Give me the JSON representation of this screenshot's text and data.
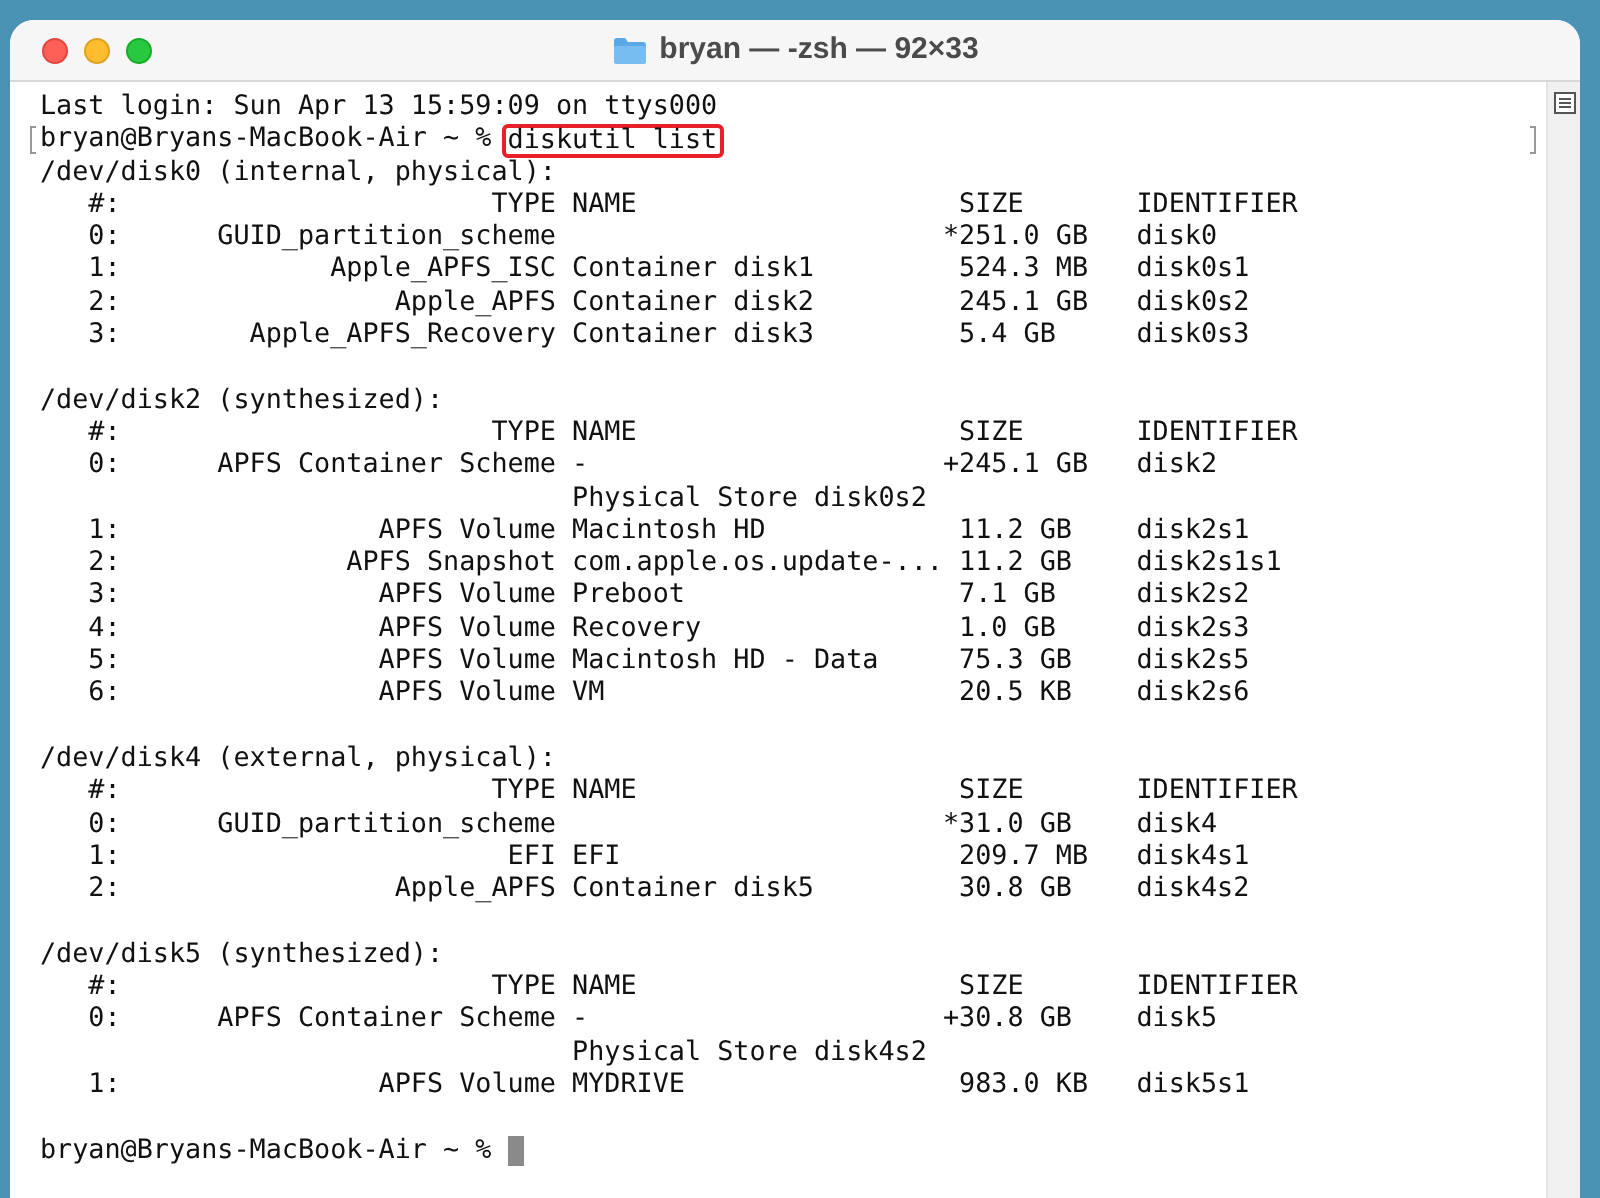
{
  "window": {
    "title": "bryan — -zsh — 92×33"
  },
  "terminal": {
    "last_login": "Last login: Sun Apr 13 15:59:09 on ttys000",
    "command_line": {
      "prompt": "bryan@Bryans-MacBook-Air ~ % ",
      "command": "diskutil list",
      "highlighted": true
    },
    "disks": [
      {
        "header": "/dev/disk0 (internal, physical):",
        "rows": [
          {
            "number": "#:",
            "type": "TYPE",
            "name": "NAME",
            "size": "SIZE",
            "identifier": "IDENTIFIER"
          },
          {
            "number": "0:",
            "type": "GUID_partition_scheme",
            "name": "",
            "size": "*251.0 GB",
            "identifier": "disk0"
          },
          {
            "number": "1:",
            "type": "Apple_APFS_ISC",
            "name": "Container disk1",
            "size": "524.3 MB",
            "identifier": "disk0s1"
          },
          {
            "number": "2:",
            "type": "Apple_APFS",
            "name": "Container disk2",
            "size": "245.1 GB",
            "identifier": "disk0s2"
          },
          {
            "number": "3:",
            "type": "Apple_APFS_Recovery",
            "name": "Container disk3",
            "size": "5.4 GB",
            "identifier": "disk0s3"
          }
        ]
      },
      {
        "header": "/dev/disk2 (synthesized):",
        "rows": [
          {
            "number": "#:",
            "type": "TYPE",
            "name": "NAME",
            "size": "SIZE",
            "identifier": "IDENTIFIER"
          },
          {
            "number": "0:",
            "type": "APFS Container Scheme",
            "name": "-",
            "size": "+245.1 GB",
            "identifier": "disk2"
          },
          {
            "number": "",
            "type": "",
            "name": "Physical Store disk0s2",
            "size": "",
            "identifier": ""
          },
          {
            "number": "1:",
            "type": "APFS Volume",
            "name": "Macintosh HD",
            "size": "11.2 GB",
            "identifier": "disk2s1"
          },
          {
            "number": "2:",
            "type": "APFS Snapshot",
            "name": "com.apple.os.update-...",
            "size": "11.2 GB",
            "identifier": "disk2s1s1"
          },
          {
            "number": "3:",
            "type": "APFS Volume",
            "name": "Preboot",
            "size": "7.1 GB",
            "identifier": "disk2s2"
          },
          {
            "number": "4:",
            "type": "APFS Volume",
            "name": "Recovery",
            "size": "1.0 GB",
            "identifier": "disk2s3"
          },
          {
            "number": "5:",
            "type": "APFS Volume",
            "name": "Macintosh HD - Data",
            "size": "75.3 GB",
            "identifier": "disk2s5"
          },
          {
            "number": "6:",
            "type": "APFS Volume",
            "name": "VM",
            "size": "20.5 KB",
            "identifier": "disk2s6"
          }
        ]
      },
      {
        "header": "/dev/disk4 (external, physical):",
        "rows": [
          {
            "number": "#:",
            "type": "TYPE",
            "name": "NAME",
            "size": "SIZE",
            "identifier": "IDENTIFIER"
          },
          {
            "number": "0:",
            "type": "GUID_partition_scheme",
            "name": "",
            "size": "*31.0 GB",
            "identifier": "disk4"
          },
          {
            "number": "1:",
            "type": "EFI",
            "name": "EFI",
            "size": "209.7 MB",
            "identifier": "disk4s1"
          },
          {
            "number": "2:",
            "type": "Apple_APFS",
            "name": "Container disk5",
            "size": "30.8 GB",
            "identifier": "disk4s2"
          }
        ]
      },
      {
        "header": "/dev/disk5 (synthesized):",
        "rows": [
          {
            "number": "#:",
            "type": "TYPE",
            "name": "NAME",
            "size": "SIZE",
            "identifier": "IDENTIFIER"
          },
          {
            "number": "0:",
            "type": "APFS Container Scheme",
            "name": "-",
            "size": "+30.8 GB",
            "identifier": "disk5"
          },
          {
            "number": "",
            "type": "",
            "name": "Physical Store disk4s2",
            "size": "",
            "identifier": ""
          },
          {
            "number": "1:",
            "type": "APFS Volume",
            "name": "MYDRIVE",
            "size": "983.0 KB",
            "identifier": "disk5s1"
          }
        ]
      }
    ],
    "final_prompt": "bryan@Bryans-MacBook-Air ~ % "
  }
}
